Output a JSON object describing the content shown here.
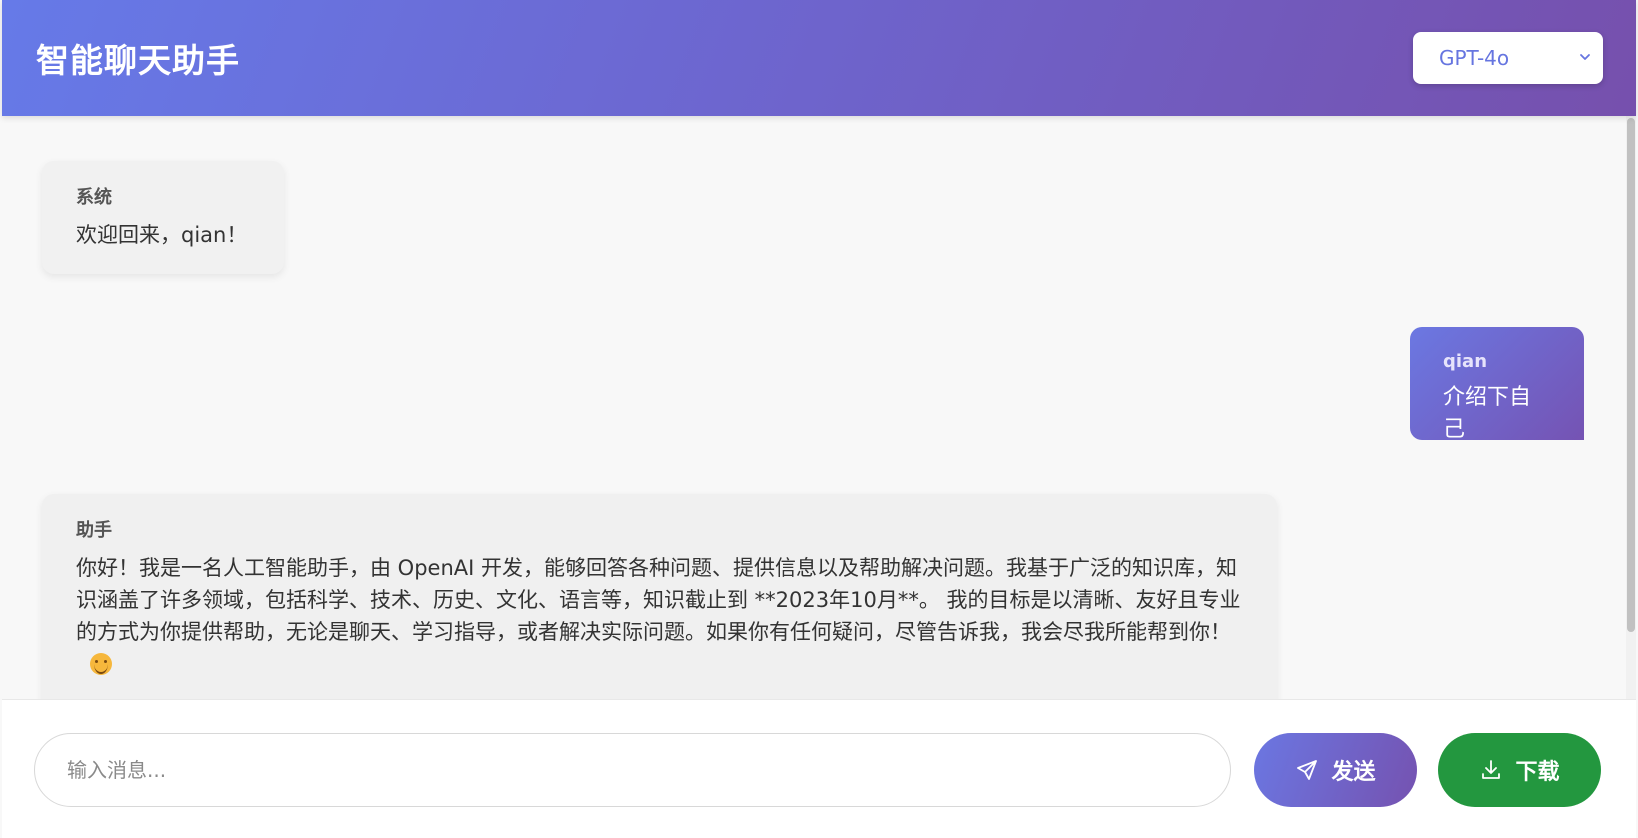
{
  "header": {
    "title": "智能聊天助手",
    "model_select": {
      "selected": "GPT-4o"
    }
  },
  "messages": [
    {
      "role_label": "系统",
      "text": "欢迎回来，qian！"
    },
    {
      "role_label": "qian",
      "text": "介绍下自己"
    },
    {
      "role_label": "助手",
      "text": "你好！我是一名人工智能助手，由 OpenAI 开发，能够回答各种问题、提供信息以及帮助解决问题。我基于广泛的知识库，知识涵盖了许多领域，包括科学、技术、历史、文化、语言等，知识截止到 **2023年10月**。 我的目标是以清晰、友好且专业的方式为你提供帮助，无论是聊天、学习指导，或者解决实际问题。如果你有任何疑问，尽管告诉我，我会尽我所能帮到你！"
    }
  ],
  "composer": {
    "placeholder": "输入消息...",
    "value": "",
    "send_label": "发送",
    "download_label": "下载"
  },
  "icons": {
    "model_chevron": "chevron-down-icon",
    "send": "paper-plane-icon",
    "download": "download-icon",
    "emoji": "smiling-face-icon"
  },
  "colors": {
    "header_gradient_start": "#667ae8",
    "header_gradient_end": "#7650ad",
    "accent": "#6675e0",
    "download_green": "#23973f"
  }
}
